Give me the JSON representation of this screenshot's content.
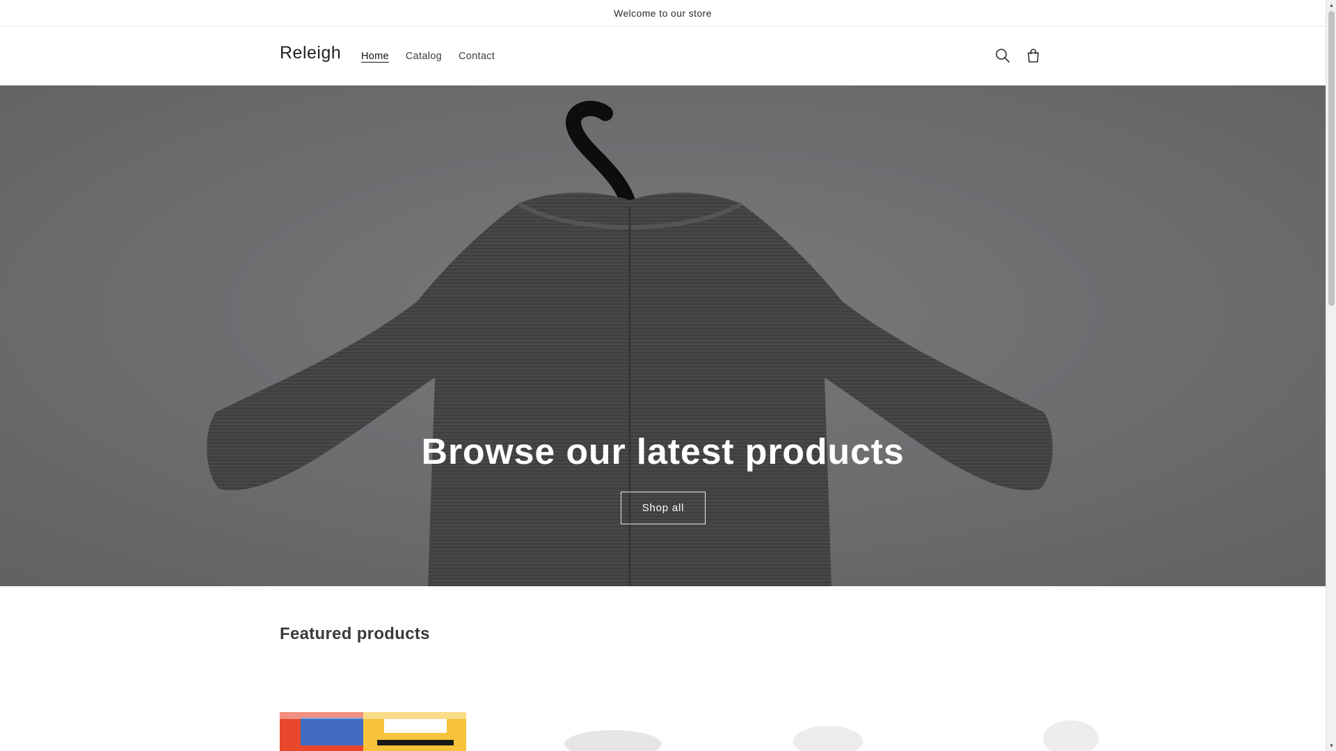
{
  "announcement": {
    "text": "Welcome to our store"
  },
  "header": {
    "logo": "Releigh",
    "nav": [
      {
        "label": "Home",
        "active": true
      },
      {
        "label": "Catalog",
        "active": false
      },
      {
        "label": "Contact",
        "active": false
      }
    ],
    "icons": {
      "search": "search-icon",
      "cart": "cart-icon"
    }
  },
  "hero": {
    "title": "Browse our latest products",
    "button": "Shop all"
  },
  "featured": {
    "title": "Featured products"
  },
  "colors": {
    "text": "#121212",
    "border": "#e6e6e6",
    "hero_overlay": "#000000"
  }
}
